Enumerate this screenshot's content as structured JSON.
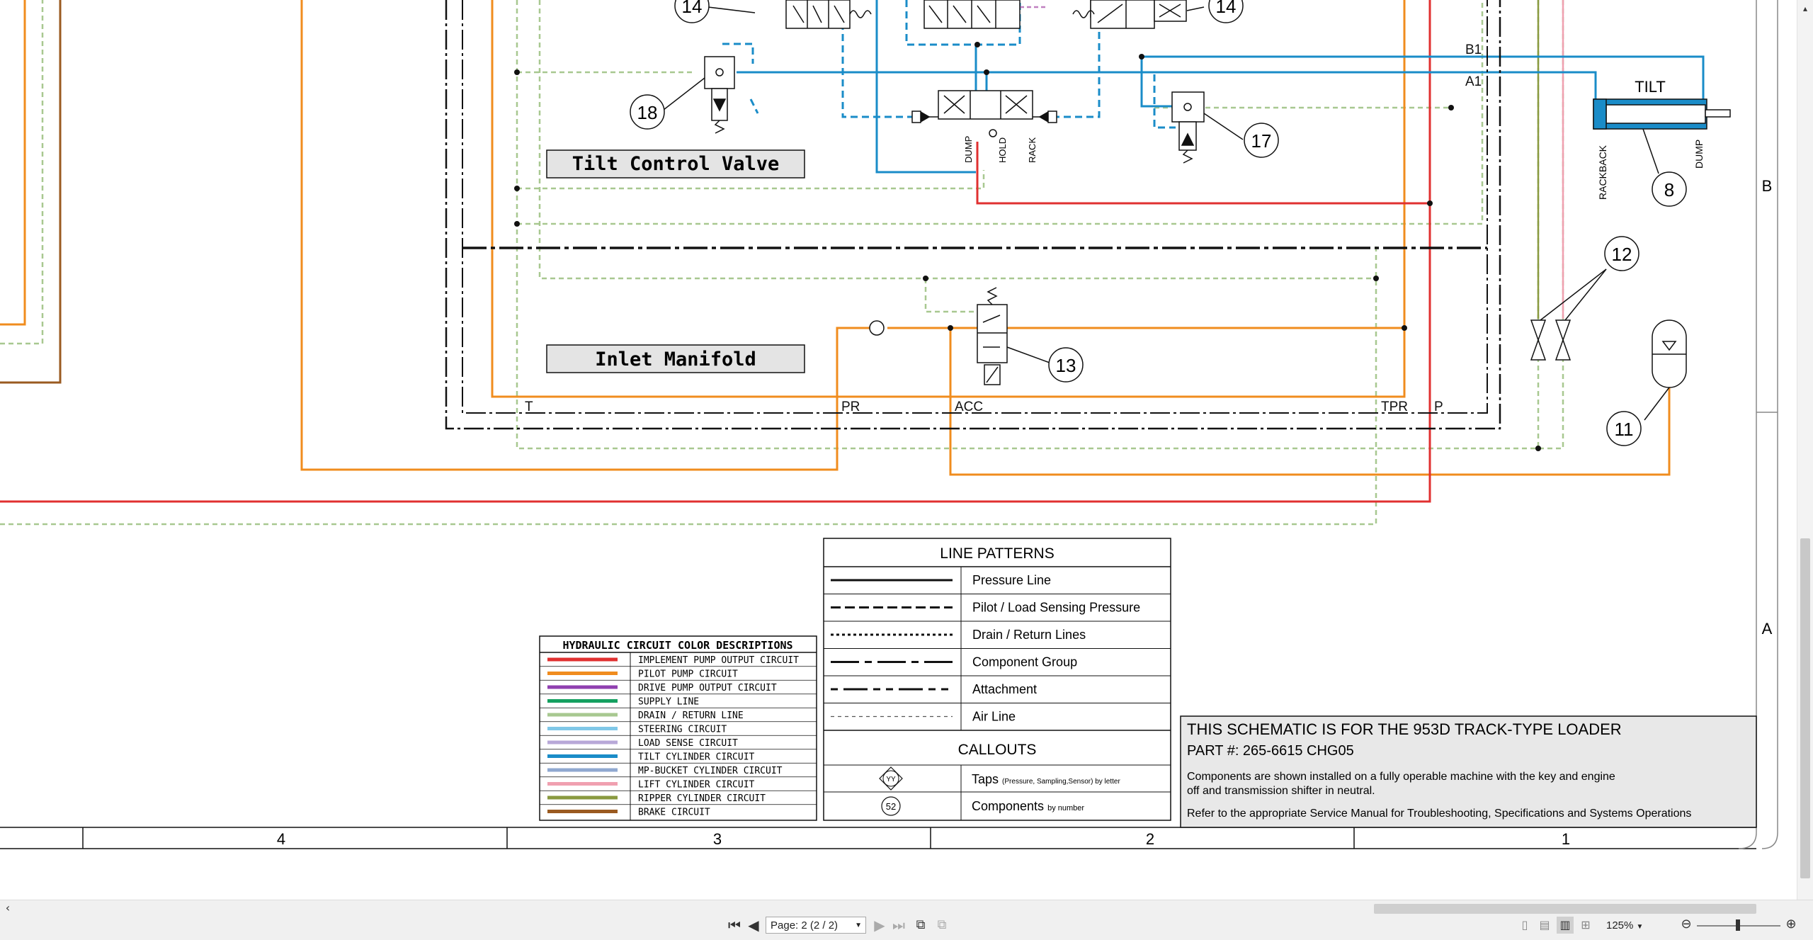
{
  "schematic": {
    "callouts": [
      "14",
      "14",
      "18",
      "17",
      "8",
      "12",
      "13",
      "11"
    ],
    "valve_labels": [
      "DUMP",
      "HOLD",
      "RACK"
    ],
    "tilt": {
      "title": "TILT",
      "rackback": "RACKBACK",
      "dump": "DUMP"
    },
    "ports": {
      "b1": "B1",
      "a1": "A1",
      "t": "T",
      "pr": "PR",
      "acc": "ACC",
      "tpr": "TPR",
      "p": "P"
    },
    "groups": {
      "tilt_control_valve": "Tilt Control Valve",
      "inlet_manifold": "Inlet Manifold"
    },
    "row_labels": [
      "B",
      "A"
    ],
    "column_labels": [
      "4",
      "3",
      "2",
      "1"
    ]
  },
  "color_legend": {
    "title": "HYDRAULIC CIRCUIT COLOR DESCRIPTIONS",
    "items": [
      {
        "label": "IMPLEMENT PUMP OUTPUT CIRCUIT",
        "color": "#e03030"
      },
      {
        "label": "PILOT PUMP CIRCUIT",
        "color": "#f08c1e"
      },
      {
        "label": "DRIVE PUMP OUTPUT CIRCUIT",
        "color": "#9040b0"
      },
      {
        "label": "SUPPLY LINE",
        "color": "#15a060"
      },
      {
        "label": "DRAIN / RETURN LINE",
        "color": "#a8c890"
      },
      {
        "label": "STEERING CIRCUIT",
        "color": "#80c8e8"
      },
      {
        "label": "LOAD SENSE CIRCUIT",
        "color": "#b8a8d8"
      },
      {
        "label": "TILT CYLINDER CIRCUIT",
        "color": "#1a8cc8"
      },
      {
        "label": "MP-BUCKET CYLINDER CIRCUIT",
        "color": "#90a8d0"
      },
      {
        "label": "LIFT CYLINDER CIRCUIT",
        "color": "#f0a0b0"
      },
      {
        "label": "RIPPER CYLINDER CIRCUIT",
        "color": "#8a9a40"
      },
      {
        "label": "BRAKE CIRCUIT",
        "color": "#9a5a20"
      }
    ]
  },
  "line_patterns": {
    "title": "LINE PATTERNS",
    "items": [
      "Pressure Line",
      "Pilot / Load Sensing Pressure",
      "Drain / Return Lines",
      "Component Group",
      "Attachment",
      "Air Line"
    ],
    "callouts_title": "CALLOUTS",
    "taps_symbol": "YY",
    "taps_label": "Taps",
    "taps_note": "(Pressure, Sampling,Sensor) by letter",
    "components_symbol": "52",
    "components_label": "Components",
    "components_note": "by number"
  },
  "title_block": {
    "line1": "THIS SCHEMATIC IS FOR THE 953D TRACK-TYPE LOADER",
    "line2": "PART #: 265-6615 CHG05",
    "note1a": "Components are shown installed on a fully operable machine with the key and engine",
    "note1b": "off and transmission shifter in neutral.",
    "note2": "Refer to the appropriate Service Manual for Troubleshooting, Specifications and Systems Operations"
  },
  "viewer": {
    "page_select": "Page: 2 (2 / 2)",
    "zoom": "125%"
  },
  "colors": {
    "pressure": "#e03030",
    "pilot": "#f08c1e",
    "tilt": "#1a8cc8",
    "drain": "#a8c890",
    "lift": "#f0a0b0",
    "ripper": "#8a9a40",
    "brake": "#9a5a20"
  }
}
